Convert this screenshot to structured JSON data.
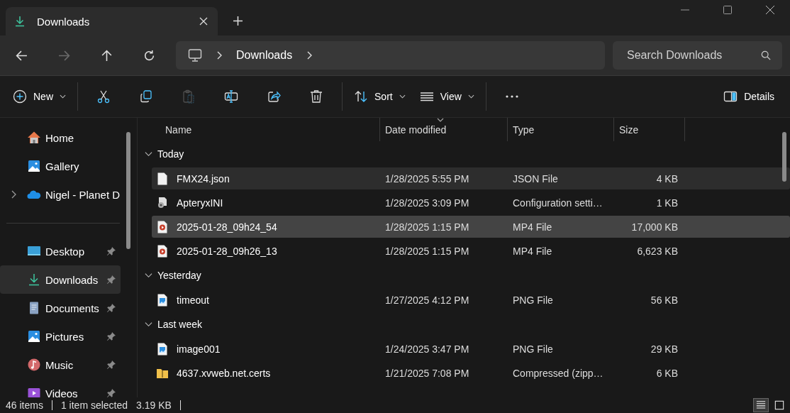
{
  "tab": {
    "title": "Downloads",
    "selected": true
  },
  "navigation": [
    {
      "kind": "back",
      "disabled": false
    },
    {
      "kind": "forward",
      "disabled": true
    },
    {
      "kind": "up",
      "disabled": false
    },
    {
      "kind": "refresh",
      "disabled": false
    }
  ],
  "breadcrumb": [
    "Downloads"
  ],
  "search": {
    "placeholder": "Search Downloads"
  },
  "commands": [
    {
      "kind": "new",
      "label": "New",
      "disabled": false
    },
    {
      "kind": "sep"
    },
    {
      "kind": "cut",
      "disabled": false
    },
    {
      "kind": "copy",
      "disabled": false
    },
    {
      "kind": "paste",
      "disabled": true
    },
    {
      "kind": "rename",
      "disabled": false
    },
    {
      "kind": "share",
      "disabled": false
    },
    {
      "kind": "delete",
      "disabled": false
    },
    {
      "kind": "sep"
    },
    {
      "kind": "sort",
      "label": "Sort",
      "disabled": false
    },
    {
      "kind": "view",
      "label": "View",
      "disabled": false
    },
    {
      "kind": "sep"
    },
    {
      "kind": "more",
      "disabled": false
    }
  ],
  "details": {
    "label": "Details"
  },
  "sidebar": {
    "groups": [
      [
        {
          "label": "Home",
          "kind": "home",
          "selected": false,
          "pinned": false
        },
        {
          "label": "Gallery",
          "kind": "gallery",
          "selected": false,
          "pinned": false
        },
        {
          "label": "Nigel - Planet D",
          "kind": "cloud",
          "selected": false,
          "pinned": false,
          "expanded": false
        }
      ],
      [
        {
          "label": "Desktop",
          "kind": "desktop",
          "selected": false,
          "pinned": true
        },
        {
          "label": "Downloads",
          "kind": "downloads",
          "selected": true,
          "pinned": true
        },
        {
          "label": "Documents",
          "kind": "documents",
          "selected": false,
          "pinned": true
        },
        {
          "label": "Pictures",
          "kind": "pictures",
          "selected": false,
          "pinned": true
        },
        {
          "label": "Music",
          "kind": "music",
          "selected": false,
          "pinned": true
        },
        {
          "label": "Videos",
          "kind": "videos",
          "selected": false,
          "pinned": true
        }
      ]
    ]
  },
  "columns": [
    {
      "label": "Name",
      "sorted": false
    },
    {
      "label": "Date modified",
      "sorted": true
    },
    {
      "label": "Type",
      "sorted": false
    },
    {
      "label": "Size",
      "sorted": false
    }
  ],
  "groups": [
    {
      "label": "Today",
      "expanded": true,
      "files": [
        {
          "name": "FMX24.json",
          "date": "1/28/2025 5:55 PM",
          "type": "JSON File",
          "size": "4 KB",
          "kind": "doc",
          "selected": false,
          "hovered": true
        },
        {
          "name": "ApteryxINI",
          "date": "1/28/2025 3:09 PM",
          "type": "Configuration setti…",
          "size": "1 KB",
          "kind": "config",
          "selected": false,
          "hovered": false
        },
        {
          "name": "2025-01-28_09h24_54",
          "date": "1/28/2025 1:15 PM",
          "type": "MP4 File",
          "size": "17,000 KB",
          "kind": "video",
          "selected": true,
          "hovered": false
        },
        {
          "name": "2025-01-28_09h26_13",
          "date": "1/28/2025 1:15 PM",
          "type": "MP4 File",
          "size": "6,623 KB",
          "kind": "video",
          "selected": false,
          "hovered": false
        }
      ]
    },
    {
      "label": "Yesterday",
      "expanded": true,
      "files": [
        {
          "name": "timeout",
          "date": "1/27/2025 4:12 PM",
          "type": "PNG File",
          "size": "56 KB",
          "kind": "image",
          "selected": false,
          "hovered": false
        }
      ]
    },
    {
      "label": "Last week",
      "expanded": true,
      "files": [
        {
          "name": "image001",
          "date": "1/24/2025 3:47 PM",
          "type": "PNG File",
          "size": "29 KB",
          "kind": "image",
          "selected": false,
          "hovered": false
        },
        {
          "name": "4637.xvweb.net.certs",
          "date": "1/21/2025 7:08 PM",
          "type": "Compressed (zipp…",
          "size": "6 KB",
          "kind": "zip",
          "selected": false,
          "hovered": false
        }
      ]
    }
  ],
  "status_bar": {
    "count": "46 items",
    "selection": "1 item selected",
    "size": "3.19 KB"
  },
  "view_modes": [
    {
      "kind": "details",
      "selected": true
    },
    {
      "kind": "tiles",
      "selected": false
    }
  ]
}
